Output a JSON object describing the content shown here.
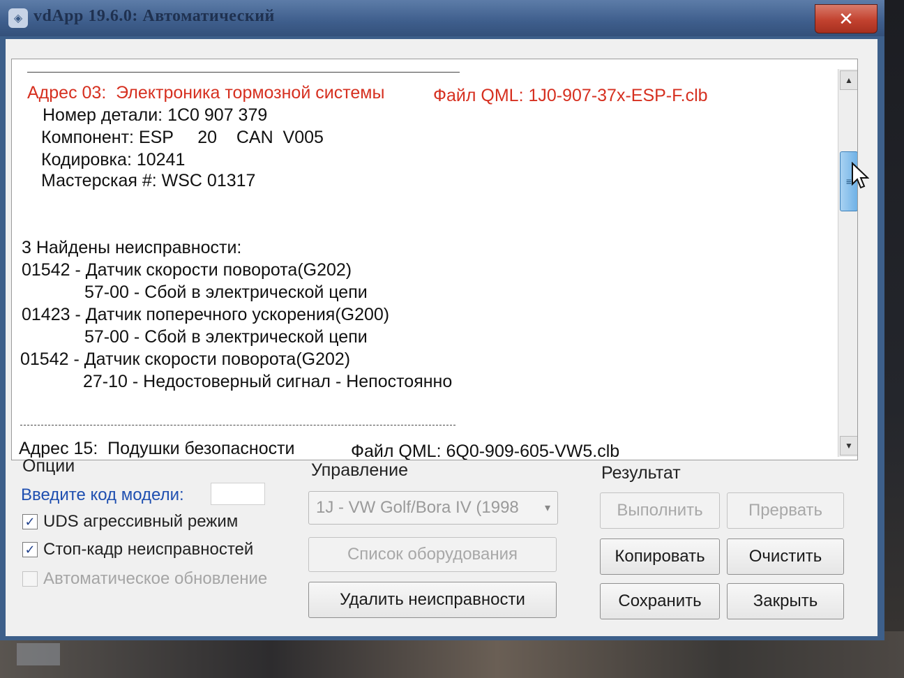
{
  "window": {
    "title": "vdApp 19.6.0: Автоматический",
    "close_symbol": "✕"
  },
  "log": {
    "lines": [
      "Адрес 03:  Электроника тормозной системы",
      "Файл QML: 1J0-907-37x-ESP-F.clb",
      "Номер детали: 1C0 907 379",
      "Компонент: ESP     20    CAN  V005",
      "Кодировка: 10241",
      "Мастерская #: WSC 01317",
      "3 Найдены неисправности:",
      "01542 - Датчик скорости поворота(G202)",
      "57-00 - Сбой в электрической цепи",
      "01423 - Датчик поперечного ускорения(G200)",
      "57-00 - Сбой в электрической цепи",
      "01542 - Датчик скорости поворота(G202)",
      "27-10 - Недостоверный сигнал - Непостоянно",
      "Адрес 15:  Подушки безопасности",
      "Файл QML: 6Q0-909-605-VW5.clb"
    ]
  },
  "options": {
    "title": "Опции",
    "model_code_label": "Введите код модели:",
    "model_code_value": "",
    "checkboxes": [
      {
        "label": "UDS агрессивный режим",
        "checked": "✓"
      },
      {
        "label": "Стоп-кадр неисправностей",
        "checked": "✓"
      },
      {
        "label": "Автоматическое обновление",
        "checked": ""
      }
    ]
  },
  "control": {
    "title": "Управление",
    "model_select": "1J - VW Golf/Bora IV (1998",
    "equipment_list_button": "Список оборудования",
    "delete_faults_button": "Удалить неисправности"
  },
  "result": {
    "title": "Результат",
    "execute_button": "Выполнить",
    "abort_button": "Прервать",
    "copy_button": "Копировать",
    "clear_button": "Очистить",
    "save_button": "Сохранить",
    "close_button": "Закрыть"
  },
  "colors": {
    "address_header": "#d63020",
    "model_label": "#1f4fb0"
  }
}
